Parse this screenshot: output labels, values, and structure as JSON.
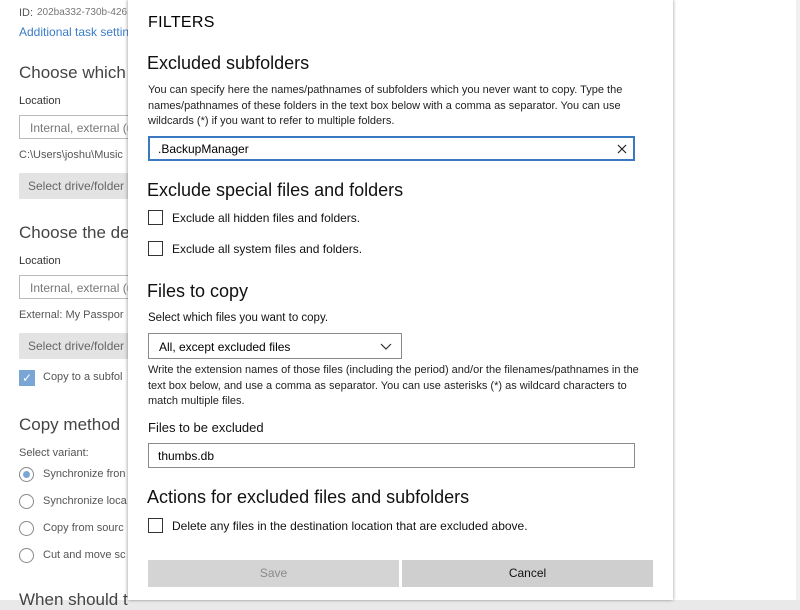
{
  "background": {
    "id_label": "ID:",
    "id_value": "202ba332-730b-426",
    "additional_settings_link": "Additional task settin",
    "choose_source_heading": "Choose which",
    "source_location_label": "Location",
    "source_location_placeholder": "Internal, external (u",
    "source_path": "C:\\Users\\joshu\\Music",
    "source_select_button": "Select drive/folder",
    "choose_dest_heading": "Choose the de",
    "dest_location_label": "Location",
    "dest_location_placeholder": "Internal, external (u",
    "dest_path": "External: My Passpor",
    "dest_select_button": "Select drive/folder",
    "copy_subfolder_check": "Copy to a subfol",
    "copy_method_heading": "Copy method",
    "select_variant_label": "Select variant:",
    "variants": [
      "Synchronize fron",
      "Synchronize loca",
      "Copy from sourc",
      "Cut and move sc"
    ],
    "when_heading": "When should t"
  },
  "dialog": {
    "title": "FILTERS",
    "excluded_subfolders": {
      "heading": "Excluded subfolders",
      "description": "You can specify here the names/pathnames of subfolders which you never want to copy. Type the names/pathnames of these folders in the text box below with a comma as separator. You can use wildcards (*) if you want to refer to multiple folders.",
      "value": ".BackupManager"
    },
    "exclude_special": {
      "heading": "Exclude special files and folders",
      "hidden_label": "Exclude all hidden files and folders.",
      "system_label": "Exclude all system files and folders."
    },
    "files_to_copy": {
      "heading": "Files to copy",
      "select_label": "Select which files you want to copy.",
      "selected_option": "All, except excluded files",
      "description": "Write the extension names of those files (including the period) and/or the filenames/pathnames in the text box below, and use a comma as separator. You can use asterisks (*) as wildcard characters to match multiple files.",
      "excluded_label": "Files to be excluded",
      "excluded_value": "thumbs.db"
    },
    "actions": {
      "heading": "Actions for excluded files and subfolders",
      "delete_label": "Delete any files in the destination location that are excluded above."
    },
    "buttons": {
      "save": "Save",
      "cancel": "Cancel"
    }
  },
  "colors": {
    "focus_border": "#3b78c2",
    "link": "#3a7cc6",
    "accent_check": "#7aa6d6"
  }
}
